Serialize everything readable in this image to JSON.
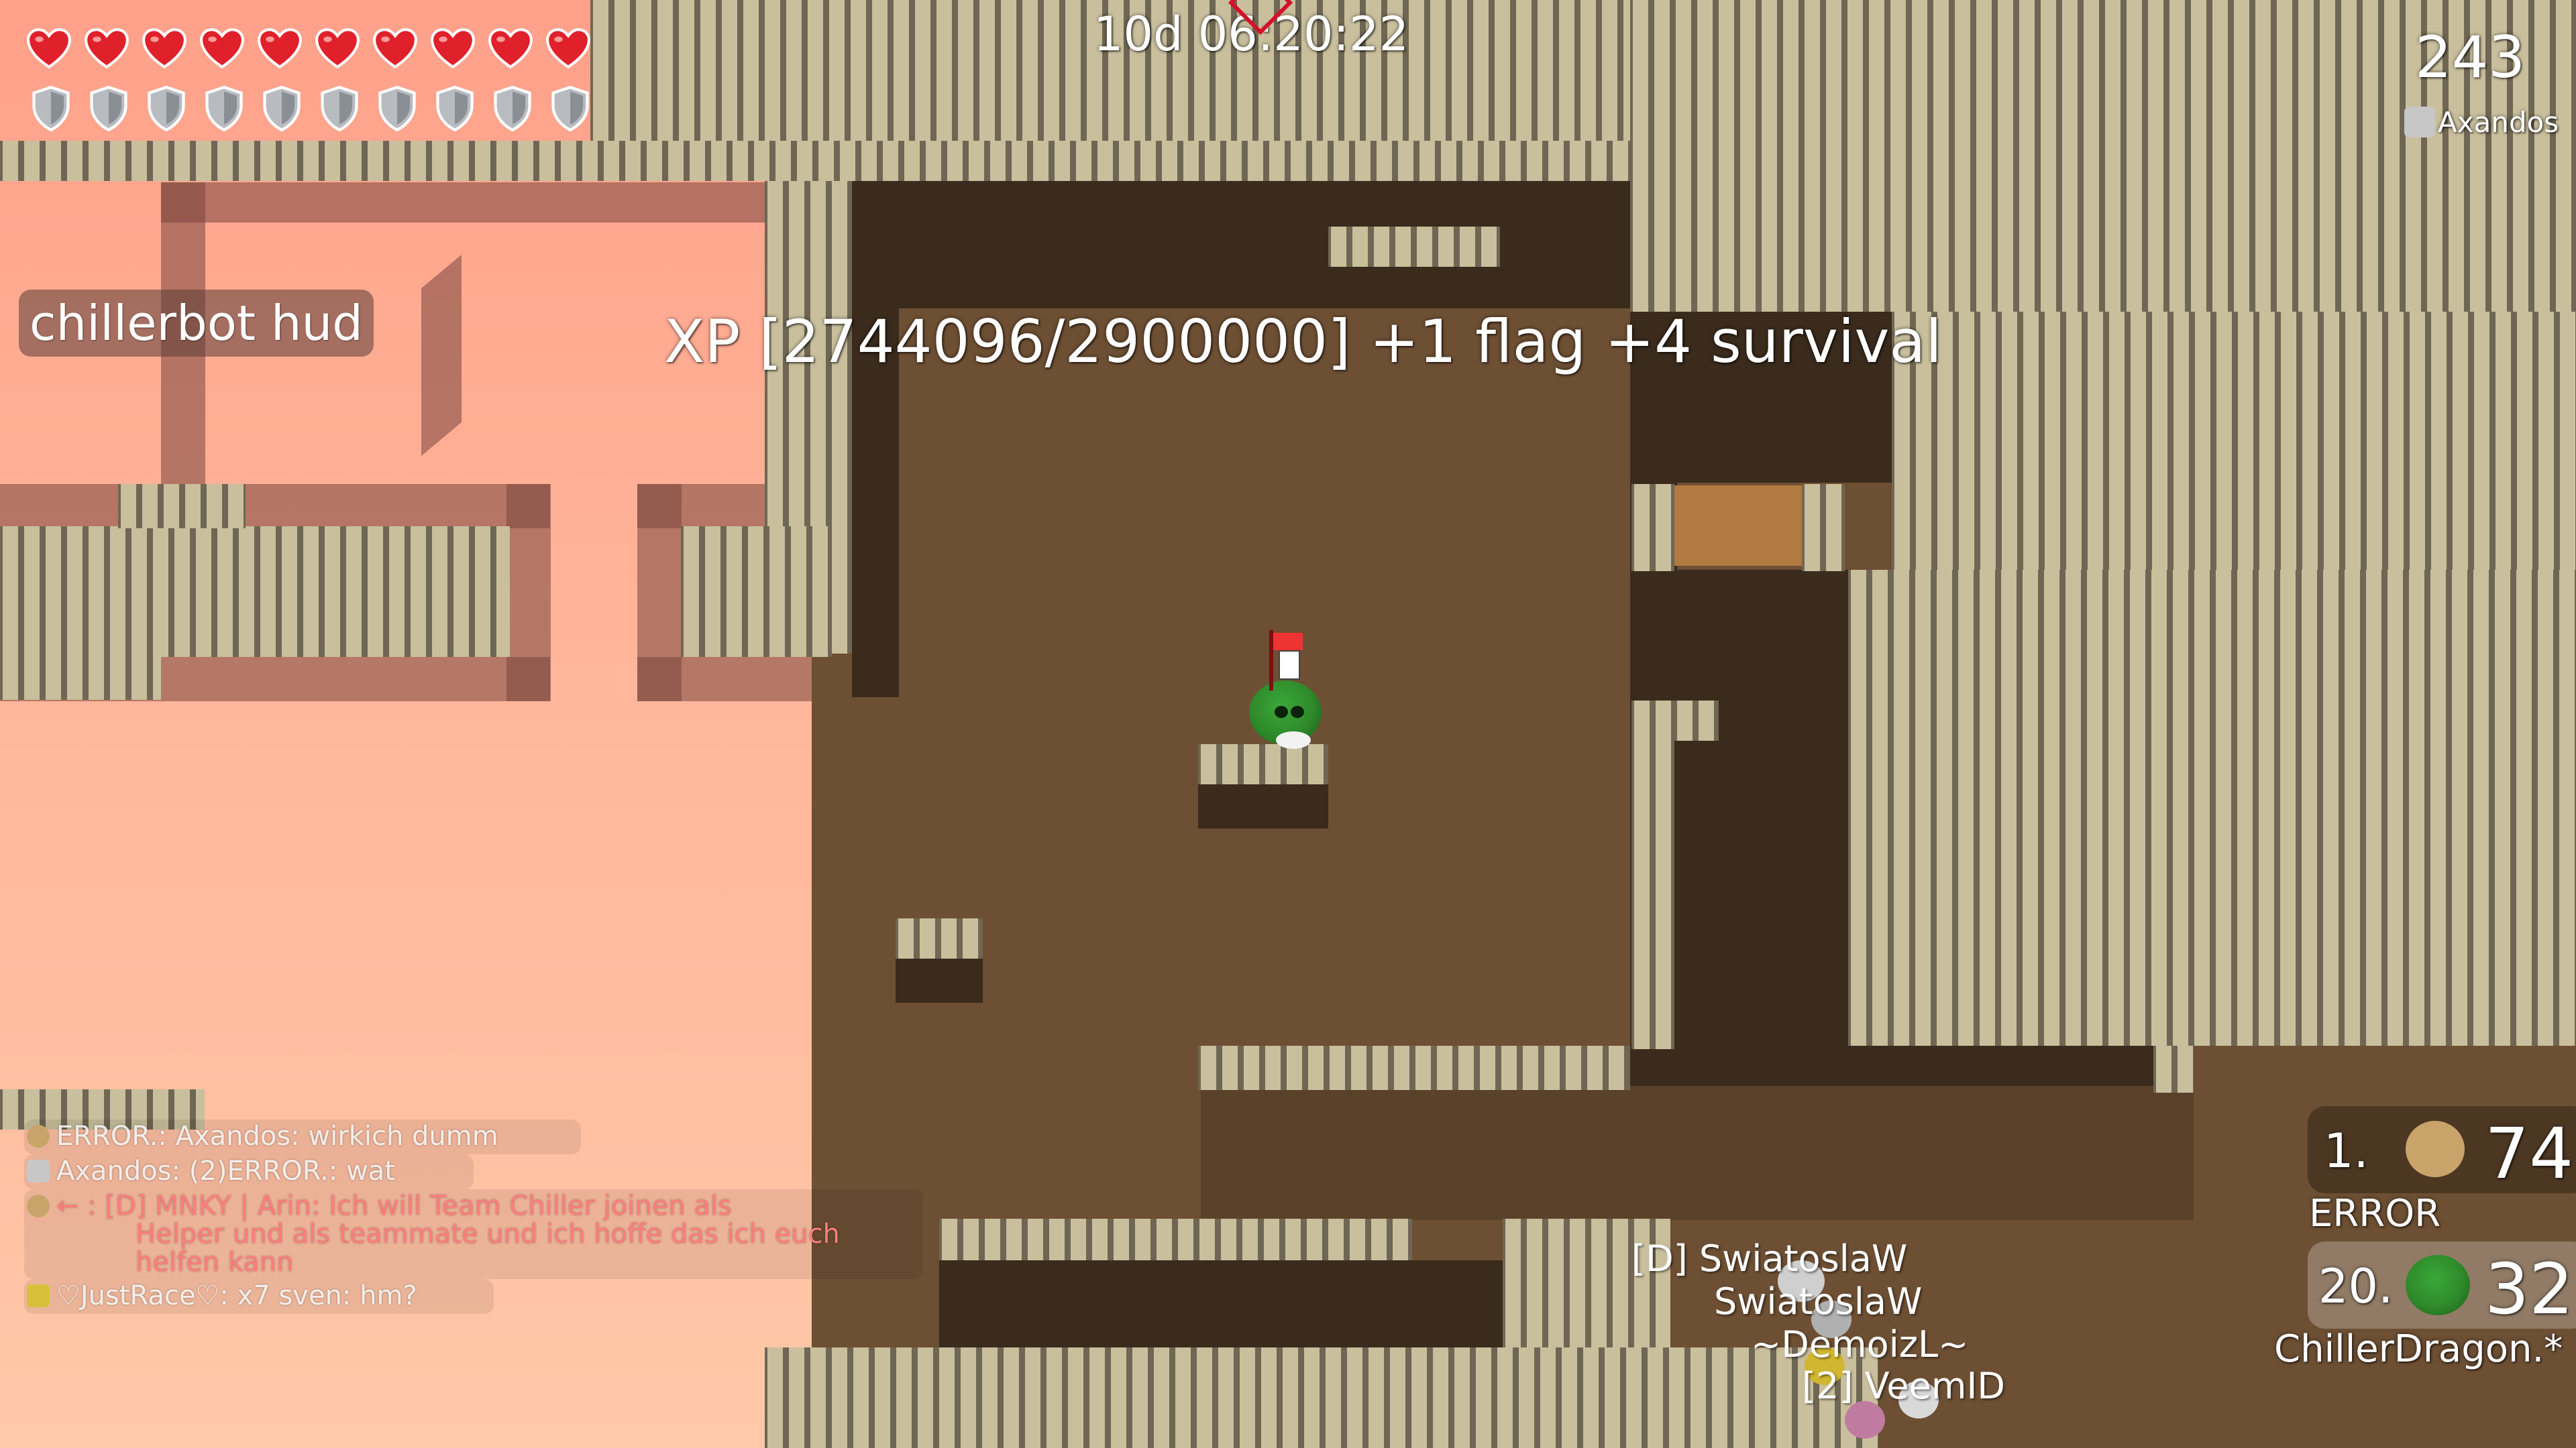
{
  "hud": {
    "timer": "10d 06:20:22",
    "score_counter": "243",
    "spectating_player": "Axandos",
    "label": "chillerbot hud",
    "xp_message": "XP [2744096/2900000] +1 flag +4 survival",
    "health_count": 10,
    "armor_count": 10
  },
  "chat": [
    {
      "author": "ERROR.:",
      "text": "Axandos:  wirkich dumm",
      "icon": "tee-icon",
      "color": "#ffffff"
    },
    {
      "author": "Axandos:",
      "text": "(2)ERROR.:  wat",
      "icon": "cat-tee-icon",
      "color": "#ffffff"
    },
    {
      "author": "←",
      "text": ": [D] MNKY | Arin:  Ich will Team Chiller joinen als",
      "icon": "tee-icon",
      "color": "#ff8080"
    },
    {
      "author": "",
      "text": "Helper und als teammate und ich hoffe das ich euch",
      "icon": "",
      "color": "#ff8080"
    },
    {
      "author": "",
      "text": "helfen kann",
      "icon": "",
      "color": "#ff8080"
    },
    {
      "author": "♡JustRace♡:",
      "text": "x7 sven:  hm?",
      "icon": "yellow-tee-icon",
      "color": "#ffffff"
    }
  ],
  "scoreboard": [
    {
      "rank": "1.",
      "score": "74",
      "name": "ERROR",
      "skin_color": "#c8a46a"
    },
    {
      "rank": "20.",
      "score": "32",
      "name": "ChillerDragon.*",
      "skin_color": "#2f8a2a"
    }
  ],
  "players": [
    {
      "name": "[D] SwiatoslaW"
    },
    {
      "name": "SwiatoslaW"
    },
    {
      "name": "~DemoizL~"
    },
    {
      "name": "[2] VeemID"
    }
  ],
  "colors": {
    "sky": "#ffb59a",
    "tile": "#c9bf9d",
    "dirt": "#6d4f33",
    "heart": "#e0202a",
    "shield": "#b8bcc0",
    "player_skin": "#2f8a2a"
  }
}
